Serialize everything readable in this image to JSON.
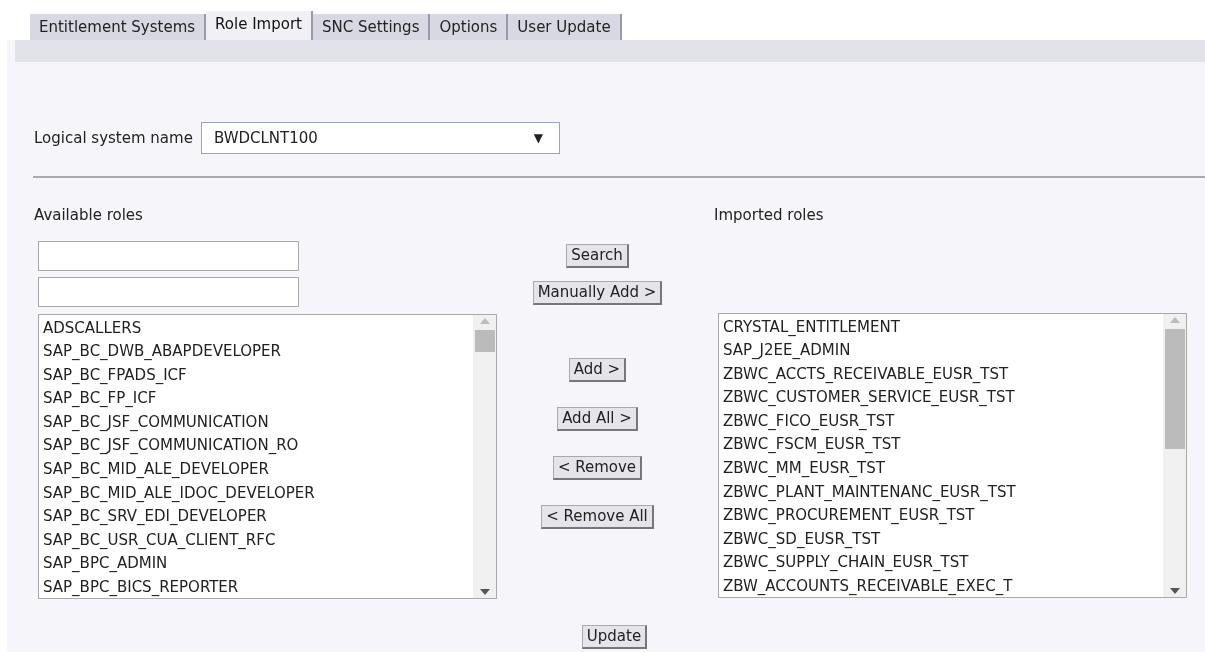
{
  "tabs": [
    {
      "label": "Entitlement Systems",
      "selected": false
    },
    {
      "label": "Role Import",
      "selected": true
    },
    {
      "label": "SNC Settings",
      "selected": false
    },
    {
      "label": "Options",
      "selected": false
    },
    {
      "label": "User Update",
      "selected": false
    }
  ],
  "logical_system": {
    "label": "Logical system name",
    "value": "BWDCLNT100",
    "arrow": "▼"
  },
  "available": {
    "label": "Available roles",
    "items": [
      "ADSCALLERS",
      "SAP_BC_DWB_ABAPDEVELOPER",
      "SAP_BC_FPADS_ICF",
      "SAP_BC_FP_ICF",
      "SAP_BC_JSF_COMMUNICATION",
      "SAP_BC_JSF_COMMUNICATION_RO",
      "SAP_BC_MID_ALE_DEVELOPER",
      "SAP_BC_MID_ALE_IDOC_DEVELOPER",
      "SAP_BC_SRV_EDI_DEVELOPER",
      "SAP_BC_USR_CUA_CLIENT_RFC",
      "SAP_BPC_ADMIN",
      "SAP_BPC_BICS_REPORTER"
    ]
  },
  "imported": {
    "label": "Imported roles",
    "items": [
      "CRYSTAL_ENTITLEMENT",
      "SAP_J2EE_ADMIN",
      "ZBWC_ACCTS_RECEIVABLE_EUSR_TST",
      "ZBWC_CUSTOMER_SERVICE_EUSR_TST",
      "ZBWC_FICO_EUSR_TST",
      "ZBWC_FSCM_EUSR_TST",
      "ZBWC_MM_EUSR_TST",
      "ZBWC_PLANT_MAINTENANC_EUSR_TST",
      "ZBWC_PROCUREMENT_EUSR_TST",
      "ZBWC_SD_EUSR_TST",
      "ZBWC_SUPPLY_CHAIN_EUSR_TST",
      "ZBW_ACCOUNTS_RECEIVABLE_EXEC_T"
    ]
  },
  "buttons": {
    "search": "Search",
    "manual_add": "Manually Add >",
    "add": "Add >",
    "add_all": "Add All >",
    "remove": "< Remove",
    "remove_all": "< Remove All",
    "update": "Update"
  }
}
